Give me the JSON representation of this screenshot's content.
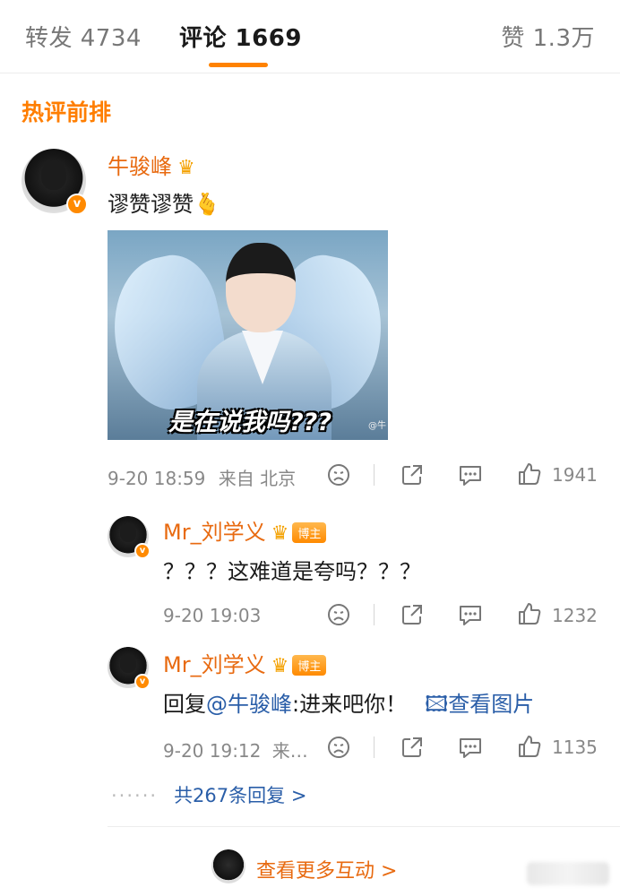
{
  "tabs": {
    "repost_label": "转发 4734",
    "comment_label": "评论 1669",
    "like_label": "赞 1.3万"
  },
  "section_title": "热评前排",
  "comments": [
    {
      "username": "牛骏峰",
      "text": "谬赞谬赞🫰",
      "image_caption": "是在说我吗???",
      "image_watermark": "@牛",
      "time": "9-20 18:59",
      "source": "来自 北京",
      "likes": "1941"
    }
  ],
  "replies": [
    {
      "username": "Mr_刘学义",
      "badge": "博主",
      "text": "？？？这难道是夸吗？？？",
      "time": "9-20 19:03",
      "likes": "1232"
    },
    {
      "username": "Mr_刘学义",
      "badge": "博主",
      "reply_prefix": "回复",
      "mention": "@牛骏峰",
      "text": ":进来吧你！",
      "view_image": "查看图片",
      "time": "9-20 19:12",
      "source": "来…",
      "likes": "1135"
    }
  ],
  "more_replies": "共267条回复 >",
  "more_interactions": "查看更多互动 >",
  "colors": {
    "accent": "#ff8200",
    "username": "#e86a10",
    "link": "#2a5ea8"
  }
}
